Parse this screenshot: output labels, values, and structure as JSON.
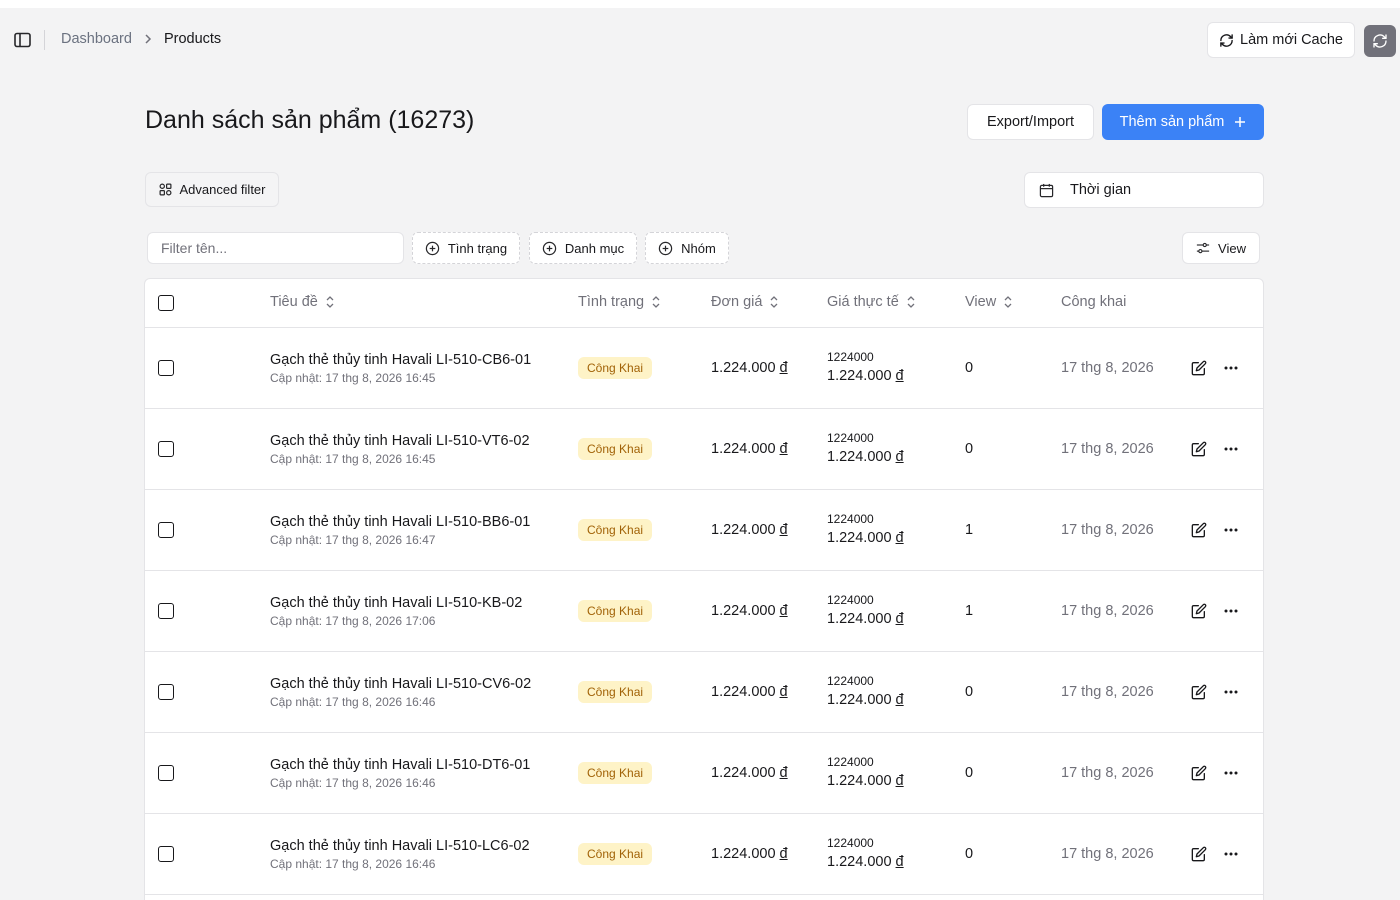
{
  "header": {
    "breadcrumb": [
      {
        "label": "Dashboard"
      },
      {
        "label": "Products"
      }
    ],
    "cache_button_label": "Làm mới Cache"
  },
  "page": {
    "title": "Danh sách sản phẩm (16273)",
    "export_label": "Export/Import",
    "add_label": "Thêm sản phẩm"
  },
  "filters": {
    "advanced_label": "Advanced filter",
    "time_label": "Thời gian",
    "name_placeholder": "Filter tên...",
    "facets": [
      "Tình trạng",
      "Danh mục",
      "Nhóm"
    ],
    "view_label": "View"
  },
  "table": {
    "columns": {
      "title": "Tiêu đề",
      "status": "Tình trạng",
      "unit_price": "Đơn giá",
      "real_price": "Giá thực tế",
      "views": "View",
      "published": "Công khai"
    },
    "rows": [
      {
        "title": "Gạch thẻ thủy tinh Havali LI-510-CB6-01",
        "updated": "Cập nhật: 17 thg 8, 2026 16:45",
        "status": "Công Khai",
        "price": "1.224.000",
        "real_raw": "1224000",
        "real_fmt": "1.224.000",
        "views": "0",
        "date": "17 thg 8, 2026"
      },
      {
        "title": "Gạch thẻ thủy tinh Havali LI-510-VT6-02",
        "updated": "Cập nhật: 17 thg 8, 2026 16:45",
        "status": "Công Khai",
        "price": "1.224.000",
        "real_raw": "1224000",
        "real_fmt": "1.224.000",
        "views": "0",
        "date": "17 thg 8, 2026"
      },
      {
        "title": "Gạch thẻ thủy tinh Havali LI-510-BB6-01",
        "updated": "Cập nhật: 17 thg 8, 2026 16:47",
        "status": "Công Khai",
        "price": "1.224.000",
        "real_raw": "1224000",
        "real_fmt": "1.224.000",
        "views": "1",
        "date": "17 thg 8, 2026"
      },
      {
        "title": "Gạch thẻ thủy tinh Havali LI-510-KB-02",
        "updated": "Cập nhật: 17 thg 8, 2026 17:06",
        "status": "Công Khai",
        "price": "1.224.000",
        "real_raw": "1224000",
        "real_fmt": "1.224.000",
        "views": "1",
        "date": "17 thg 8, 2026"
      },
      {
        "title": "Gạch thẻ thủy tinh Havali LI-510-CV6-02",
        "updated": "Cập nhật: 17 thg 8, 2026 16:46",
        "status": "Công Khai",
        "price": "1.224.000",
        "real_raw": "1224000",
        "real_fmt": "1.224.000",
        "views": "0",
        "date": "17 thg 8, 2026"
      },
      {
        "title": "Gạch thẻ thủy tinh Havali LI-510-DT6-01",
        "updated": "Cập nhật: 17 thg 8, 2026 16:46",
        "status": "Công Khai",
        "price": "1.224.000",
        "real_raw": "1224000",
        "real_fmt": "1.224.000",
        "views": "0",
        "date": "17 thg 8, 2026"
      },
      {
        "title": "Gạch thẻ thủy tinh Havali LI-510-LC6-02",
        "updated": "Cập nhật: 17 thg 8, 2026 16:46",
        "status": "Công Khai",
        "price": "1.224.000",
        "real_raw": "1224000",
        "real_fmt": "1.224.000",
        "views": "0",
        "date": "17 thg 8, 2026"
      }
    ],
    "currency_symbol": "đ"
  },
  "colors": {
    "accent": "#3b82f6",
    "badge_bg": "#fef3c7",
    "badge_text": "#a16207",
    "background": "#f3f3f4"
  },
  "icons": [
    "sidebar-toggle-icon",
    "chevron-right-icon",
    "refresh-icon",
    "plus-icon",
    "filter-icon",
    "calendar-icon",
    "plus-circle-icon",
    "sliders-icon",
    "sort-icon",
    "edit-icon",
    "more-icon"
  ]
}
